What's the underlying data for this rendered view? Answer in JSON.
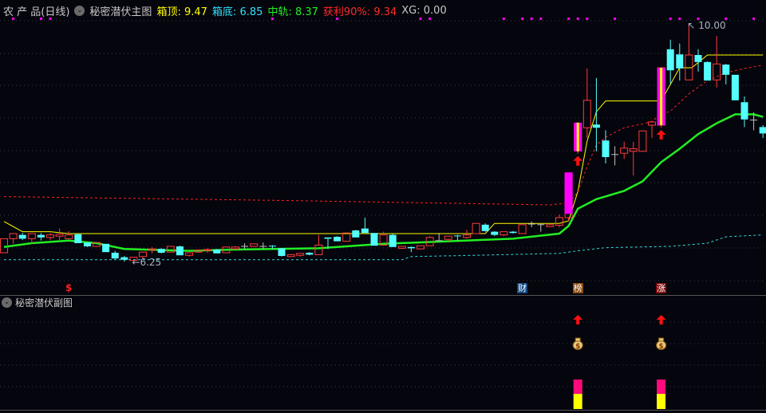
{
  "header": {
    "symbol": "农 产 品(日线)",
    "indicator": "秘密潜伏主图",
    "box_top_label": "箱顶:",
    "box_top_value": "9.47",
    "box_bottom_label": "箱底:",
    "box_bottom_value": "6.85",
    "mid_label": "中轨:",
    "mid_value": "8.37",
    "profit_label": "获利90%:",
    "profit_value": "9.34",
    "xg_label": "XG:",
    "xg_value": "0.00"
  },
  "sub_header": {
    "indicator": "秘密潜伏副图"
  },
  "tags": [
    {
      "index": 7,
      "text": "$",
      "bg": "transparent",
      "color": "#ff2020"
    },
    {
      "index": 56,
      "text": "财",
      "bg": "#12467e",
      "color": "#ffffff"
    },
    {
      "index": 62,
      "text": "榜",
      "bg": "#8a4a10",
      "color": "#ffffff"
    },
    {
      "index": 71,
      "text": "涨",
      "bg": "#800c0c",
      "color": "#ffffff"
    }
  ],
  "colors": {
    "up": "#ff3b3b",
    "down": "#54ffff",
    "flat": "#c0c0c0",
    "box_top": "#ffff00",
    "box_bottom": "#33dddd",
    "mid": "#22ee22",
    "profit": "#ff2020",
    "signal": "#ff00ff",
    "signal_stripe": "#ffff00",
    "dot": "#ff00ff"
  },
  "chart_data": {
    "type": "candlestick",
    "price_range": [
      6.1,
      10.15
    ],
    "annotations": [
      {
        "index": 14,
        "text": "←6.25",
        "price": 6.25
      },
      {
        "index": 74,
        "text": "10.00",
        "price": 10.0
      }
    ],
    "candles": [
      [
        6.4,
        6.62,
        6.4,
        6.62
      ],
      [
        6.62,
        6.7,
        6.54,
        6.7
      ],
      [
        6.68,
        6.71,
        6.6,
        6.62
      ],
      [
        6.62,
        6.7,
        6.54,
        6.7
      ],
      [
        6.68,
        6.71,
        6.59,
        6.64
      ],
      [
        6.64,
        6.71,
        6.6,
        6.68
      ],
      [
        6.66,
        6.78,
        6.6,
        6.69
      ],
      [
        6.62,
        6.74,
        6.61,
        6.68
      ],
      [
        6.69,
        6.7,
        6.55,
        6.55
      ],
      [
        6.56,
        6.56,
        6.49,
        6.5
      ],
      [
        6.5,
        6.56,
        6.5,
        6.56
      ],
      [
        6.54,
        6.54,
        6.41,
        6.41
      ],
      [
        6.4,
        6.43,
        6.3,
        6.31
      ],
      [
        6.33,
        6.35,
        6.26,
        6.29
      ],
      [
        6.28,
        6.33,
        6.28,
        6.33
      ],
      [
        6.34,
        6.41,
        6.3,
        6.41
      ],
      [
        6.44,
        6.49,
        6.39,
        6.46
      ],
      [
        6.46,
        6.47,
        6.39,
        6.4
      ],
      [
        6.41,
        6.5,
        6.41,
        6.5
      ],
      [
        6.5,
        6.51,
        6.36,
        6.36
      ],
      [
        6.36,
        6.4,
        6.34,
        6.4
      ],
      [
        6.41,
        6.45,
        6.4,
        6.44
      ],
      [
        6.44,
        6.47,
        6.4,
        6.45
      ],
      [
        6.45,
        6.46,
        6.39,
        6.39
      ],
      [
        6.4,
        6.49,
        6.4,
        6.49
      ],
      [
        6.46,
        6.5,
        6.45,
        6.49
      ],
      [
        6.5,
        6.55,
        6.46,
        6.5
      ],
      [
        6.5,
        6.54,
        6.49,
        6.54
      ],
      [
        6.5,
        6.56,
        6.46,
        6.5
      ],
      [
        6.51,
        6.52,
        6.46,
        6.5
      ],
      [
        6.47,
        6.47,
        6.34,
        6.35
      ],
      [
        6.34,
        6.37,
        6.33,
        6.37
      ],
      [
        6.36,
        6.39,
        6.34,
        6.39
      ],
      [
        6.4,
        6.41,
        6.36,
        6.37
      ],
      [
        6.37,
        6.68,
        6.37,
        6.52
      ],
      [
        6.64,
        6.64,
        6.46,
        6.62
      ],
      [
        6.65,
        6.66,
        6.58,
        6.58
      ],
      [
        6.58,
        6.71,
        6.58,
        6.71
      ],
      [
        6.75,
        6.76,
        6.64,
        6.64
      ],
      [
        6.78,
        6.95,
        6.71,
        6.71
      ],
      [
        6.71,
        6.71,
        6.51,
        6.51
      ],
      [
        6.52,
        6.73,
        6.52,
        6.68
      ],
      [
        6.68,
        6.7,
        6.49,
        6.49
      ],
      [
        6.47,
        6.5,
        6.46,
        6.5
      ],
      [
        6.49,
        6.5,
        6.41,
        6.47
      ],
      [
        6.46,
        6.51,
        6.45,
        6.51
      ],
      [
        6.51,
        6.66,
        6.51,
        6.64
      ],
      [
        6.59,
        6.71,
        6.59,
        6.59
      ],
      [
        6.61,
        6.66,
        6.58,
        6.66
      ],
      [
        6.67,
        6.68,
        6.59,
        6.66
      ],
      [
        6.64,
        6.76,
        6.62,
        6.68
      ],
      [
        6.7,
        6.86,
        6.7,
        6.86
      ],
      [
        6.84,
        6.86,
        6.73,
        6.74
      ],
      [
        6.73,
        6.74,
        6.66,
        6.68
      ],
      [
        6.68,
        6.73,
        6.66,
        6.73
      ],
      [
        6.73,
        6.74,
        6.7,
        6.71
      ],
      [
        6.7,
        6.84,
        6.7,
        6.84
      ],
      [
        6.85,
        6.89,
        6.8,
        6.85
      ],
      [
        6.84,
        6.85,
        6.73,
        6.84
      ],
      [
        6.81,
        6.84,
        6.81,
        6.84
      ],
      [
        6.83,
        7.0,
        6.8,
        6.95
      ],
      [
        6.95,
        7.66,
        6.9,
        7.62
      ],
      [
        8.0,
        8.44,
        7.95,
        8.4
      ],
      [
        8.36,
        9.29,
        8.2,
        8.79
      ],
      [
        8.41,
        9.14,
        7.99,
        8.36
      ],
      [
        8.16,
        8.32,
        7.8,
        7.9
      ],
      [
        7.94,
        8.07,
        7.77,
        7.94
      ],
      [
        7.96,
        8.14,
        7.87,
        8.04
      ],
      [
        7.99,
        8.14,
        7.61,
        8.03
      ],
      [
        7.99,
        8.31,
        7.99,
        8.31
      ],
      [
        8.4,
        8.45,
        8.2,
        8.45
      ],
      [
        8.4,
        9.3,
        8.36,
        9.3
      ],
      [
        9.59,
        9.74,
        9.05,
        9.26
      ],
      [
        9.51,
        9.68,
        9.1,
        9.29
      ],
      [
        9.11,
        10.0,
        9.11,
        9.5
      ],
      [
        9.5,
        9.59,
        9.24,
        9.39
      ],
      [
        9.39,
        9.4,
        9.1,
        9.1
      ],
      [
        9.11,
        9.8,
        8.99,
        9.36
      ],
      [
        9.35,
        9.36,
        9.04,
        9.19
      ],
      [
        9.19,
        9.19,
        8.79,
        8.79
      ],
      [
        8.76,
        8.85,
        8.37,
        8.49
      ],
      [
        8.48,
        8.6,
        8.32,
        8.48
      ],
      [
        8.37,
        8.4,
        8.2,
        8.27
      ]
    ],
    "candle_fields": [
      "open",
      "high",
      "low",
      "close"
    ],
    "series": [
      {
        "name": "箱顶",
        "style": "solid",
        "color_key": "box_top",
        "points": [
          [
            0,
            6.89
          ],
          [
            2,
            6.73
          ],
          [
            5,
            6.73
          ],
          [
            7,
            6.7
          ],
          [
            52,
            6.7
          ],
          [
            53,
            6.86
          ],
          [
            60,
            6.86
          ],
          [
            61,
            6.9
          ],
          [
            62,
            7.36
          ],
          [
            63,
            8.15
          ],
          [
            64,
            8.61
          ],
          [
            65,
            8.78
          ],
          [
            71,
            8.78
          ],
          [
            73,
            9.3
          ],
          [
            74.3,
            9.3
          ],
          [
            76,
            9.5
          ],
          [
            82,
            9.5
          ]
        ]
      },
      {
        "name": "获利90%",
        "style": "dashed",
        "color_key": "profit",
        "points": [
          [
            0,
            7.28
          ],
          [
            30,
            7.22
          ],
          [
            59,
            7.15
          ],
          [
            61,
            7.18
          ],
          [
            62,
            7.35
          ],
          [
            63,
            7.75
          ],
          [
            64,
            8.09
          ],
          [
            65,
            8.21
          ],
          [
            67,
            8.36
          ],
          [
            69,
            8.42
          ],
          [
            70,
            8.46
          ],
          [
            71,
            8.57
          ],
          [
            72,
            8.62
          ],
          [
            74,
            8.89
          ],
          [
            76,
            9.1
          ],
          [
            78,
            9.22
          ],
          [
            80,
            9.29
          ],
          [
            82,
            9.34
          ]
        ]
      },
      {
        "name": "中轨",
        "style": "thick",
        "color_key": "mid",
        "points": [
          [
            0,
            6.49
          ],
          [
            3,
            6.55
          ],
          [
            7,
            6.59
          ],
          [
            10,
            6.55
          ],
          [
            13,
            6.46
          ],
          [
            20,
            6.43
          ],
          [
            25,
            6.45
          ],
          [
            34,
            6.47
          ],
          [
            41,
            6.54
          ],
          [
            48,
            6.58
          ],
          [
            55,
            6.62
          ],
          [
            60,
            6.7
          ],
          [
            61,
            6.82
          ],
          [
            62,
            7.09
          ],
          [
            64,
            7.24
          ],
          [
            67,
            7.37
          ],
          [
            69,
            7.52
          ],
          [
            71,
            7.82
          ],
          [
            73,
            8.03
          ],
          [
            75,
            8.26
          ],
          [
            77,
            8.43
          ],
          [
            79,
            8.57
          ],
          [
            81,
            8.57
          ],
          [
            82,
            8.53
          ]
        ]
      },
      {
        "name": "箱底",
        "style": "dashed",
        "color_key": "box_bottom",
        "points": [
          [
            0,
            6.29
          ],
          [
            43,
            6.29
          ],
          [
            44,
            6.34
          ],
          [
            51,
            6.36
          ],
          [
            60,
            6.39
          ],
          [
            62,
            6.43
          ],
          [
            65,
            6.48
          ],
          [
            72,
            6.5
          ],
          [
            76,
            6.55
          ],
          [
            78,
            6.65
          ],
          [
            82,
            6.68
          ]
        ]
      }
    ],
    "signal_bars": [
      {
        "index": 61,
        "low": 7.01,
        "high": 7.66,
        "striped": false
      },
      {
        "index": 62,
        "low": 7.99,
        "high": 8.44,
        "striped": true
      },
      {
        "index": 71,
        "low": 8.4,
        "high": 9.3,
        "striped": true
      }
    ],
    "buy_arrows": [
      62,
      71
    ],
    "dot_indices": [
      1,
      4,
      5,
      29,
      36,
      45,
      46,
      54,
      56,
      57,
      58,
      61,
      62,
      63,
      66,
      72,
      73,
      75,
      78,
      81
    ],
    "sub_signals": [
      62,
      71
    ]
  }
}
